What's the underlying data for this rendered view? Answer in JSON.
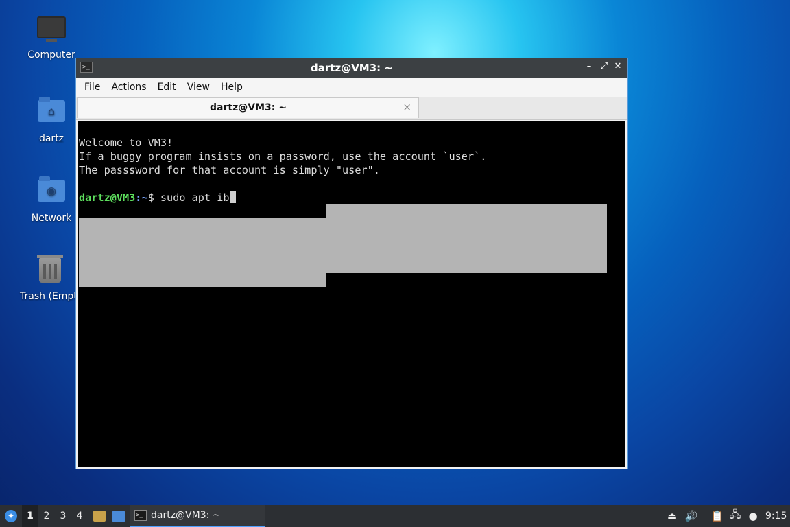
{
  "desktop": {
    "icons": [
      {
        "label": "Computer",
        "icon": "computer-icon"
      },
      {
        "label": "dartz",
        "icon": "home-folder-icon"
      },
      {
        "label": "Network",
        "icon": "network-folder-icon"
      },
      {
        "label": "Trash (Empty)",
        "icon": "trash-icon"
      }
    ]
  },
  "window": {
    "title": "dartz@VM3: ~",
    "icon": "terminal-icon",
    "controls": {
      "minimize": "–",
      "maximize": "⤢",
      "close": "✕"
    },
    "menu": [
      "File",
      "Actions",
      "Edit",
      "View",
      "Help"
    ],
    "tab": {
      "label": "dartz@VM3: ~",
      "close": "×"
    }
  },
  "terminal": {
    "lines": [
      "Welcome to VM3!",
      "If a buggy program insists on a password, use the account `user`.",
      "The passsword for that account is simply \"user\"."
    ],
    "prompt_user": "dartz@VM3",
    "prompt_sep": ":",
    "prompt_path": "~",
    "prompt_symbol": "$ ",
    "command": "sudo apt ib"
  },
  "taskbar": {
    "start_icon": "start-menu-icon",
    "workspaces": [
      "1",
      "2",
      "3",
      "4"
    ],
    "active_workspace": "1",
    "task_label": "dartz@VM3: ~",
    "clock": "9:15"
  },
  "colors": {
    "prompt_user": "#5ee05e",
    "prompt_path": "#7aa7ff",
    "window_border": "#5b9bd8",
    "task_underline": "#4ea0ff"
  }
}
